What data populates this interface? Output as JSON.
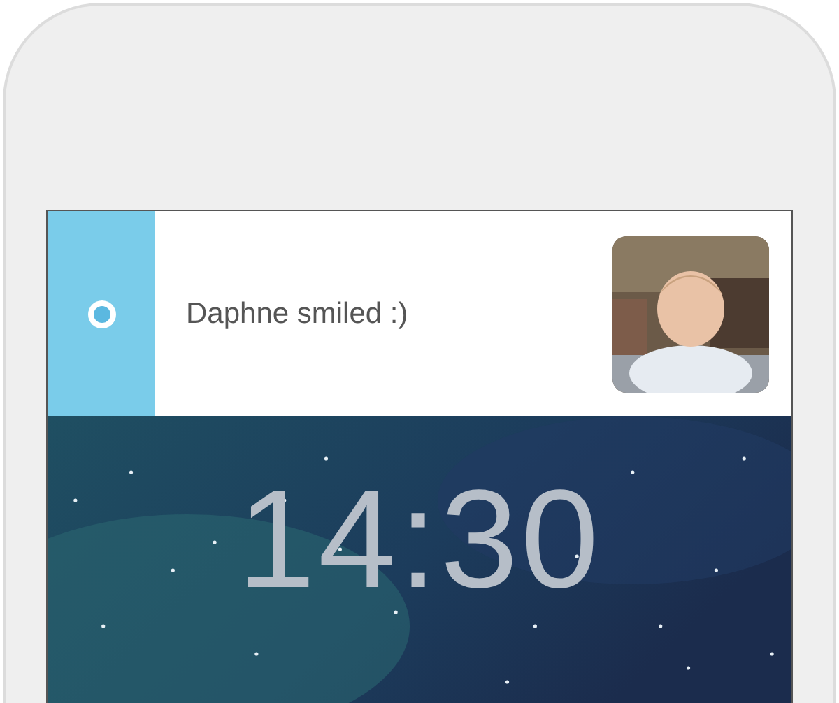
{
  "notification": {
    "text": "Daphne smiled :)"
  },
  "lock_screen": {
    "time": "14:30"
  }
}
